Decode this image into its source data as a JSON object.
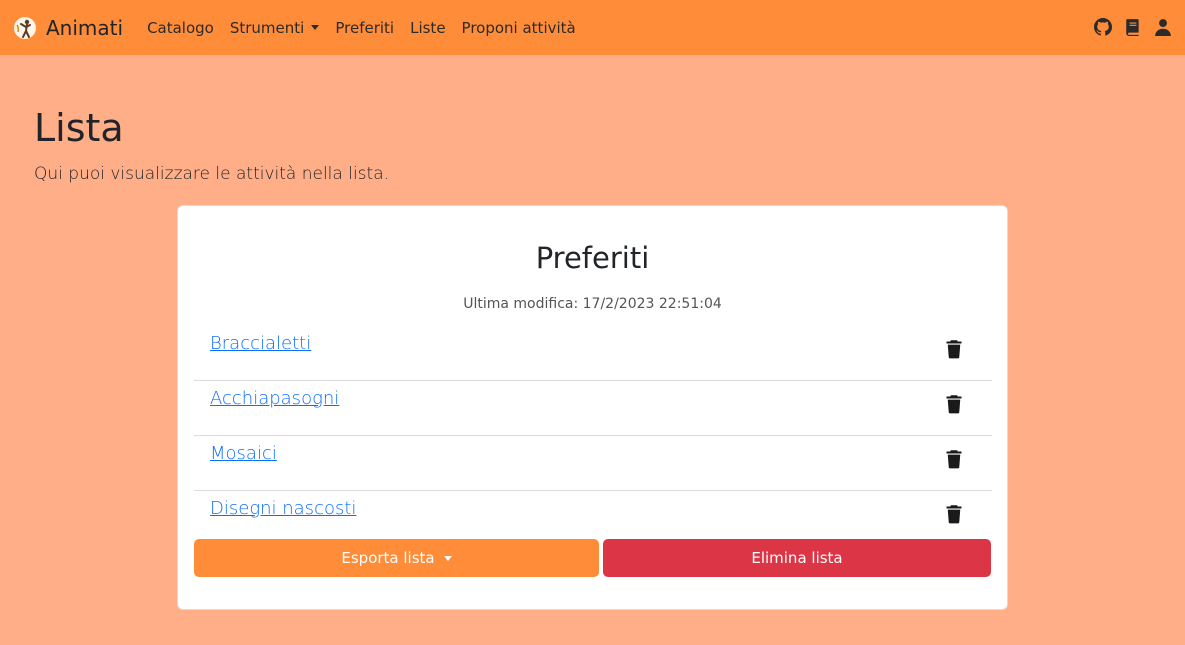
{
  "navbar": {
    "brand": "Animati",
    "links": [
      {
        "label": "Catalogo"
      },
      {
        "label": "Strumenti",
        "dropdown": true
      },
      {
        "label": "Preferiti"
      },
      {
        "label": "Liste"
      },
      {
        "label": "Proponi attività"
      }
    ],
    "icons": [
      "github-icon",
      "book-icon",
      "user-icon"
    ]
  },
  "page": {
    "title": "Lista",
    "subtitle": "Qui puoi visualizzare le attività nella lista."
  },
  "list": {
    "name": "Preferiti",
    "last_modified": "Ultima modifica: 17/2/2023 22:51:04",
    "items": [
      {
        "label": "Braccialetti"
      },
      {
        "label": "Acchiapasogni"
      },
      {
        "label": "Mosaici"
      },
      {
        "label": "Disegni nascosti"
      }
    ],
    "export_label": "Esporta lista",
    "delete_label": "Elimina lista"
  },
  "colors": {
    "navbar": "#ff8c38",
    "background": "#ffae88",
    "link": "#0d6efd",
    "danger": "#dc3545"
  }
}
